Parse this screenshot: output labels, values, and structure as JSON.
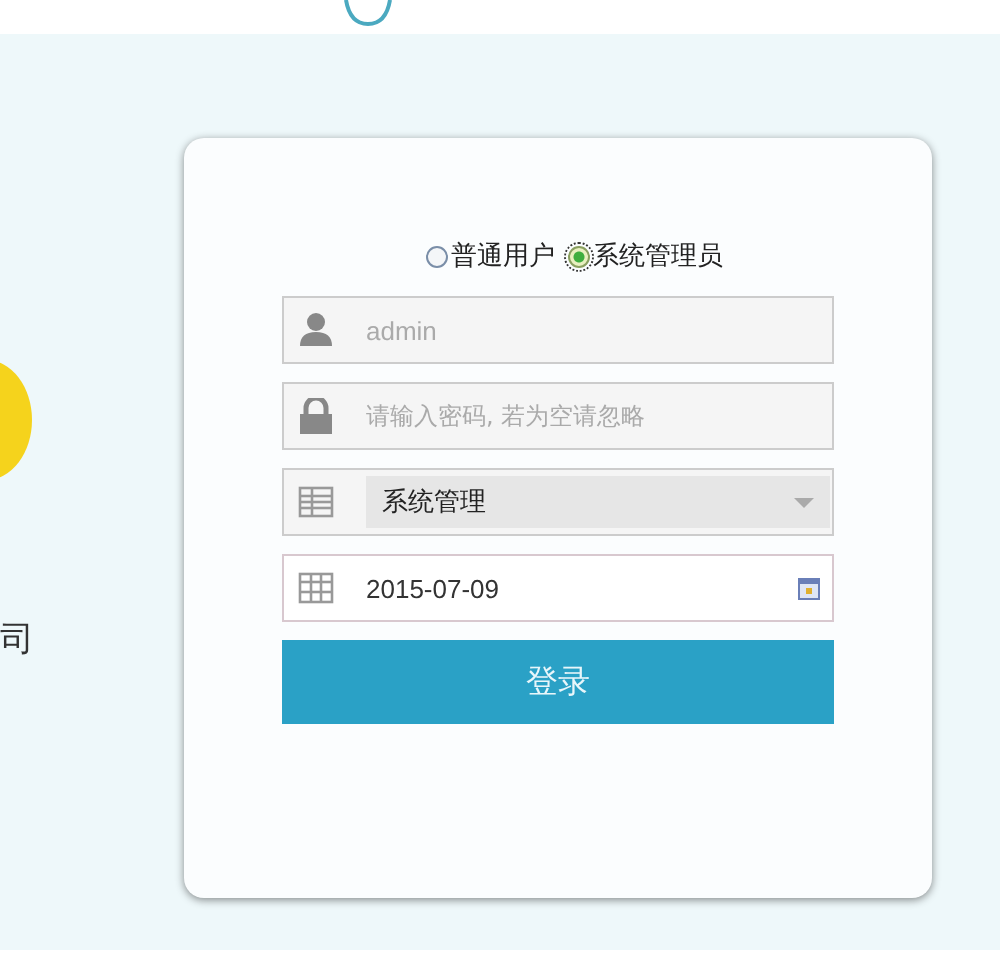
{
  "side_text": "司",
  "login_type": [
    {
      "label": "普通用户",
      "selected": false
    },
    {
      "label": "系统管理员",
      "selected": true
    }
  ],
  "fields": [
    {
      "kind": "user",
      "placeholder": "admin"
    },
    {
      "kind": "password",
      "placeholder": "请输入密码, 若为空请忽略"
    },
    {
      "kind": "select",
      "value": "系统管理"
    },
    {
      "kind": "date",
      "value": "2015-07-09"
    }
  ],
  "button": "登录"
}
